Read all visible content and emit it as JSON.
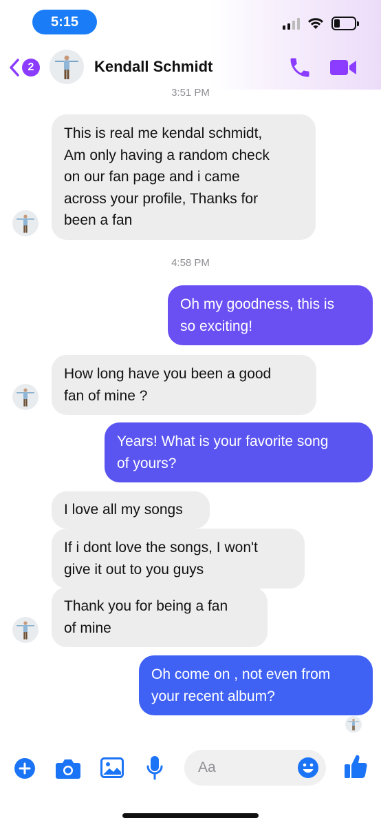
{
  "status_bar": {
    "time": "5:15",
    "battery_level": 0.3
  },
  "header": {
    "unread_count": "2",
    "contact_name": "Kendall Schmidt",
    "accent_color": "#8b3cff"
  },
  "messages": [
    {
      "type": "timestamp",
      "text": "3:51 PM"
    },
    {
      "type": "incoming",
      "text": "This is real me kendal schmidt,\nAm only having a random check\non our fan page and i came\nacross your profile, Thanks for\nbeen a fan"
    },
    {
      "type": "timestamp",
      "text": "4:58 PM"
    },
    {
      "type": "outgoing",
      "text": "Oh my goodness, this is\nso exciting!",
      "color": "#6a4ff2"
    },
    {
      "type": "incoming",
      "text": "How long have you been a good\nfan of mine ?"
    },
    {
      "type": "outgoing",
      "text": "Years! What is your favorite song\nof yours?",
      "color": "#5a54f0"
    },
    {
      "type": "incoming",
      "text": "I love all my songs"
    },
    {
      "type": "incoming",
      "text": "If i dont love the songs, I won't\ngive it out to you guys"
    },
    {
      "type": "incoming",
      "text": "Thank you for being a fan\nof mine"
    },
    {
      "type": "outgoing",
      "text": "Oh come on , not even from\nyour recent album?",
      "color": "#3f62f5"
    }
  ],
  "composer": {
    "placeholder": "Aa",
    "icons": [
      "plus-icon",
      "camera-icon",
      "image-icon",
      "microphone-icon",
      "emoji-icon",
      "thumbs-up-icon"
    ],
    "accent_color": "#1b73f5"
  }
}
